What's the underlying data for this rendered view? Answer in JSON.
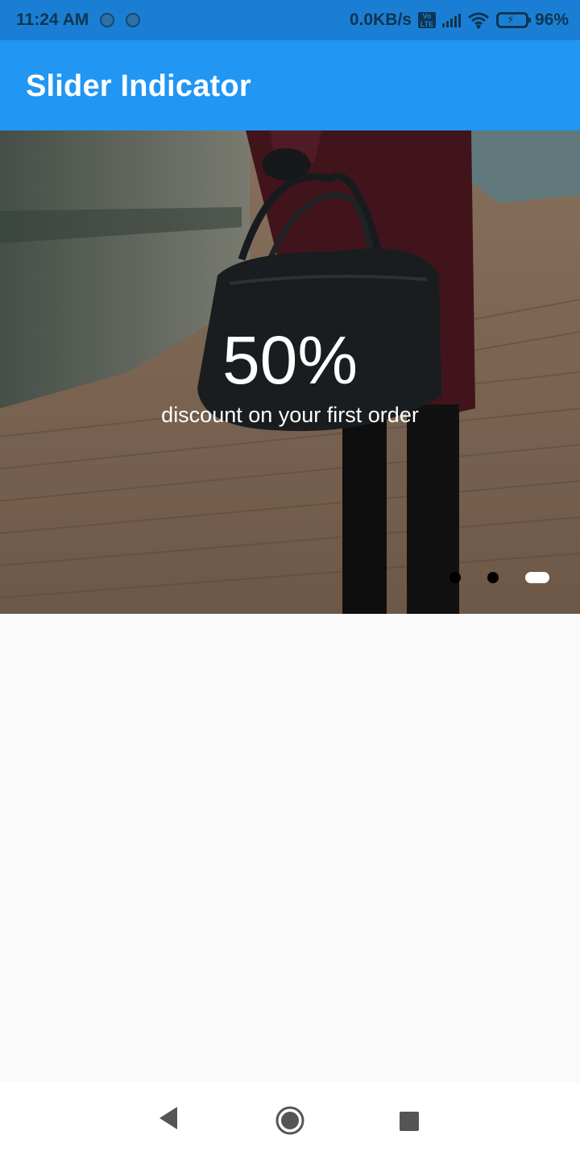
{
  "status_bar": {
    "time": "11:24 AM",
    "speed": "0.0KB/s",
    "volte": "Vo LTE",
    "battery": "96%"
  },
  "app_bar": {
    "title": "Slider Indicator"
  },
  "slider": {
    "headline": "50%",
    "subtitle": "discount on your first order",
    "slide_count": 3,
    "active_index": 2
  },
  "nav_bar": {
    "icons": [
      "back-icon",
      "home-icon",
      "recents-icon"
    ]
  },
  "colors": {
    "app_bar": "#2196f3",
    "status_bar": "#1a7fd4",
    "indicator_active": "#ffffff",
    "indicator_inactive": "#000000"
  }
}
